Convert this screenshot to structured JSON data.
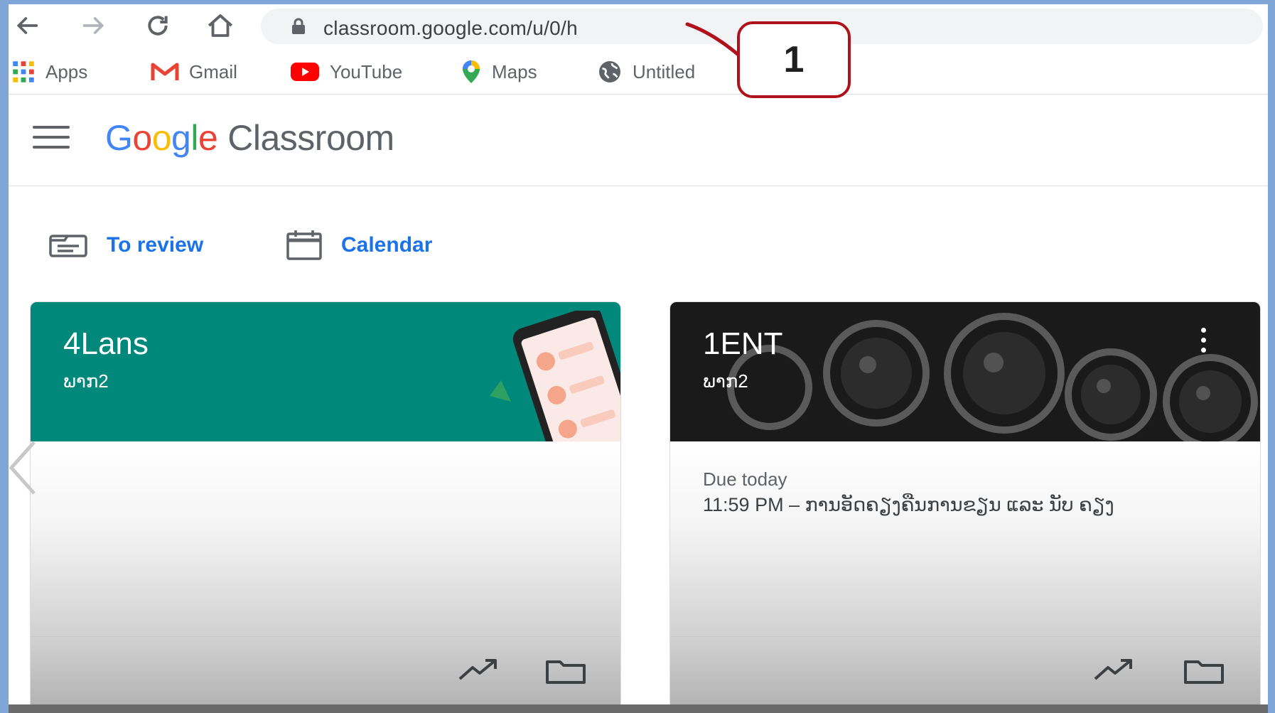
{
  "browser": {
    "url": "classroom.google.com/u/0/h",
    "bookmarks": [
      {
        "label": "Apps",
        "icon": "apps-grid-icon"
      },
      {
        "label": "Gmail",
        "icon": "gmail-icon"
      },
      {
        "label": "YouTube",
        "icon": "youtube-icon"
      },
      {
        "label": "Maps",
        "icon": "maps-icon"
      },
      {
        "label": "Untitled",
        "icon": "globe-icon"
      }
    ]
  },
  "annotation": {
    "number": "1",
    "color": "#b0121b"
  },
  "header": {
    "logo_google": [
      "G",
      "o",
      "o",
      "g",
      "l",
      "e"
    ],
    "logo_product": "Classroom"
  },
  "quick_links": {
    "review": "To review",
    "calendar": "Calendar"
  },
  "cards": [
    {
      "title": "4Lans",
      "subtitle": "ພາກ2",
      "banner_color": "#00897b",
      "due_label": "",
      "due_item": ""
    },
    {
      "title": "1ENT",
      "subtitle": "ພາກ2",
      "banner_color": "#1a1a1a",
      "due_label": "Due today",
      "due_item": "11:59 PM – ການອັດຄຽງຄືນການຂຽນ ແລະ ນັບ ຄຽງ"
    }
  ],
  "colors": {
    "accent": "#1a73e8",
    "text_secondary": "#5f6368"
  }
}
